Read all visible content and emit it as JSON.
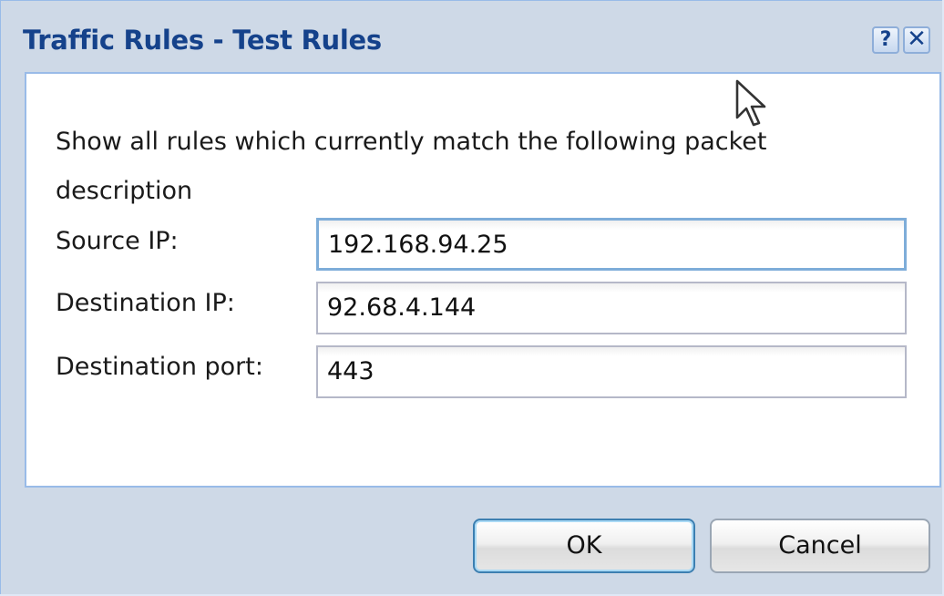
{
  "window": {
    "title": "Traffic Rules - Test Rules",
    "help_icon": "help-icon",
    "close_icon": "close-icon"
  },
  "form": {
    "description": "Show all rules which currently match the following packet description",
    "source_ip": {
      "label": "Source IP:",
      "value": "192.168.94.25"
    },
    "destination_ip": {
      "label": "Destination IP:",
      "value": "92.68.4.144"
    },
    "destination_port": {
      "label": "Destination port:",
      "value": "443"
    }
  },
  "buttons": {
    "ok": "OK",
    "cancel": "Cancel"
  },
  "colors": {
    "title_text": "#15428b",
    "frame": "#ced9e7",
    "border": "#99bbe8"
  }
}
